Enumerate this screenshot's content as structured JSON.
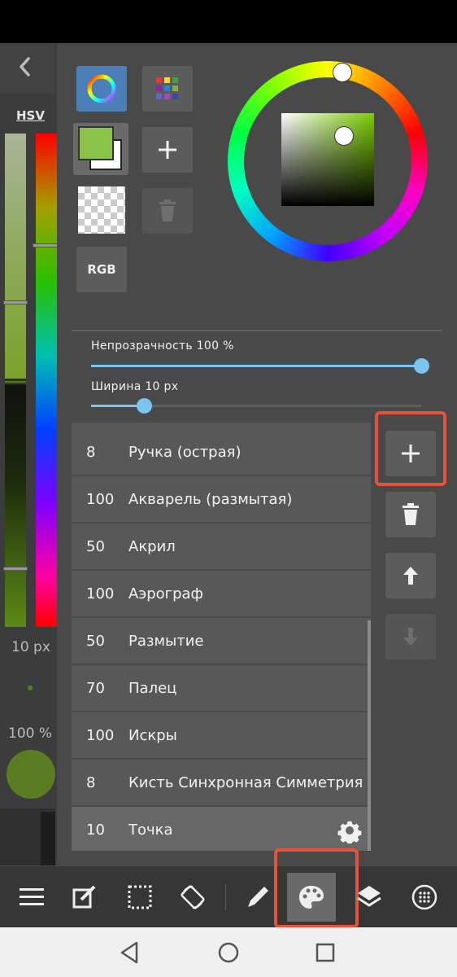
{
  "left_panel": {
    "color_mode": "HSV",
    "brush_size": "10 px",
    "opacity": "100 %"
  },
  "colors": {
    "current": "#8bc34a",
    "secondary": "#ffffff",
    "accent": "#7cc4f0",
    "highlight": "#e5533d"
  },
  "tools": {
    "rgb_label": "RGB"
  },
  "properties": {
    "opacity_label": "Непрозрачность  100  %",
    "opacity_fraction": 1.0,
    "width_label": "Ширина  10  px",
    "width_fraction": 0.16
  },
  "brushes": [
    {
      "size": "8",
      "name": "Ручка (острая)"
    },
    {
      "size": "100",
      "name": "Акварель (размытая)"
    },
    {
      "size": "50",
      "name": "Акрил"
    },
    {
      "size": "100",
      "name": "Аэрограф"
    },
    {
      "size": "50",
      "name": "Размытие"
    },
    {
      "size": "70",
      "name": "Палец"
    },
    {
      "size": "100",
      "name": "Искры"
    },
    {
      "size": "8",
      "name": "Кисть Синхронная Симметрия"
    },
    {
      "size": "10",
      "name": "Точка"
    }
  ],
  "selected_brush_index": 8,
  "icons": {
    "toolbar": [
      "menu-icon",
      "edit-icon",
      "selection-icon",
      "rotate-icon",
      "pen-icon",
      "palette-icon",
      "layers-icon",
      "material-icon"
    ],
    "nav": [
      "back-triangle-icon",
      "home-circle-icon",
      "recents-square-icon"
    ]
  }
}
